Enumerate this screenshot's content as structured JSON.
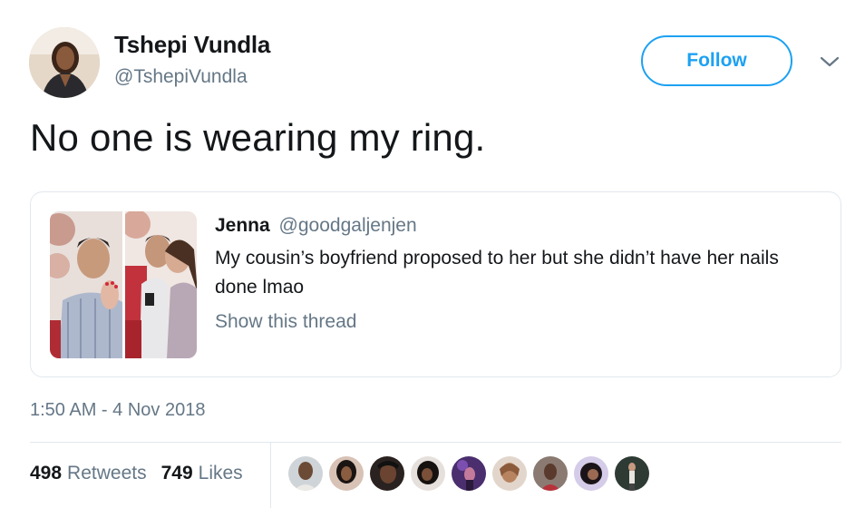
{
  "author": {
    "name": "Tshepi Vundla",
    "handle": "@TshepiVundla"
  },
  "follow_label": "Follow",
  "tweet_text": "No one is wearing my ring.",
  "quoted": {
    "name": "Jenna",
    "handle": "@goodgaljenjen",
    "text": "My cousin’s boyfriend proposed to her but she didn’t have her nails done lmao",
    "show_thread": "Show this thread"
  },
  "timestamp": "1:50 AM - 4 Nov 2018",
  "stats": {
    "retweets_count": "498",
    "retweets_label": "Retweets",
    "likes_count": "749",
    "likes_label": "Likes"
  },
  "colors": {
    "accent": "#1da1f2",
    "secondary_text": "#657786",
    "border": "#e1e8ed"
  }
}
